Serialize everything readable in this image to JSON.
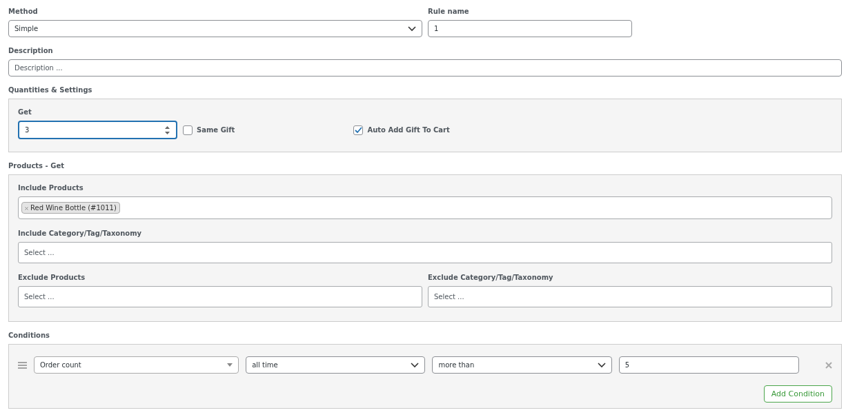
{
  "method": {
    "label": "Method",
    "value": "Simple"
  },
  "rule_name": {
    "label": "Rule name",
    "value": "1"
  },
  "description": {
    "label": "Description",
    "placeholder": "Description ..."
  },
  "quantities": {
    "title": "Quantities & Settings",
    "get_label": "Get",
    "get_value": "3",
    "get_focused": true,
    "checkboxes": [
      {
        "label": "Same Gift",
        "checked": false
      },
      {
        "label": "Auto Add Gift To Cart",
        "checked": true
      }
    ]
  },
  "products": {
    "title": "Products - Get",
    "include_products": {
      "label": "Include Products",
      "tags": [
        "Red Wine Bottle (#1011)"
      ]
    },
    "include_category": {
      "label": "Include Category/Tag/Taxonomy",
      "placeholder": "Select ..."
    },
    "exclude_products": {
      "label": "Exclude Products",
      "placeholder": "Select ..."
    },
    "exclude_category": {
      "label": "Exclude Category/Tag/Taxonomy",
      "placeholder": "Select ..."
    }
  },
  "conditions": {
    "title": "Conditions",
    "rows": [
      {
        "fields": [
          {
            "kind": "combo",
            "value": "Order count"
          },
          {
            "kind": "select",
            "value": "all time"
          },
          {
            "kind": "select",
            "value": "more than"
          },
          {
            "kind": "text",
            "value": "5"
          }
        ]
      }
    ],
    "add_button": "Add Condition"
  }
}
